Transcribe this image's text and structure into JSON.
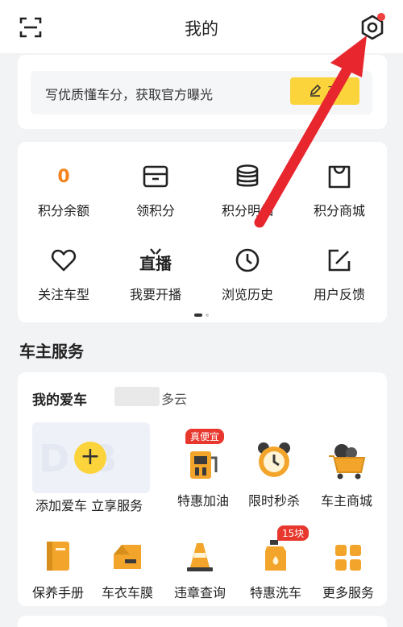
{
  "header": {
    "title": "我的",
    "scan_icon": "scan-icon",
    "settings_icon": "gear-icon"
  },
  "promo": {
    "text": "写优质懂车分，获取官方曝光",
    "button_label": "布"
  },
  "stats": [
    {
      "value": "0",
      "label": "积分余额"
    },
    {
      "icon": "box-icon",
      "label": "领积分"
    },
    {
      "icon": "coins-stack-icon",
      "label": "积分明细"
    },
    {
      "icon": "shopping-bag-icon",
      "label": "积分商城"
    }
  ],
  "shortcuts": [
    {
      "icon": "heart-icon",
      "label": "关注车型"
    },
    {
      "icon": "live-tv-icon",
      "label": "我要开播",
      "icon_text": "直播"
    },
    {
      "icon": "clock-icon",
      "label": "浏览历史"
    },
    {
      "icon": "edit-icon",
      "label": "用户反馈"
    }
  ],
  "car_services": {
    "title": "车主服务",
    "my_car_label": "我的爱车",
    "city_suffix": "多云",
    "add_car_label": "添加爱车 立享服务",
    "row1": [
      {
        "icon": "fuel-pump-icon",
        "label": "特惠加油",
        "badge": "真便宜"
      },
      {
        "icon": "alarm-clock-icon",
        "label": "限时秒杀"
      },
      {
        "icon": "shopping-cart-icon",
        "label": "车主商城"
      }
    ],
    "row2": [
      {
        "icon": "manual-book-icon",
        "label": "保养手册"
      },
      {
        "icon": "car-cover-icon",
        "label": "车衣车膜"
      },
      {
        "icon": "traffic-cone-icon",
        "label": "违章查询"
      },
      {
        "icon": "car-wash-icon",
        "label": "特惠洗车",
        "badge": "15块"
      },
      {
        "icon": "grid-icon",
        "label": "更多服务"
      }
    ]
  },
  "colors": {
    "accent_yellow": "#fbd33a",
    "orange": "#f5841f",
    "badge_red": "#e8372c",
    "arrow_red": "#e8262e"
  }
}
